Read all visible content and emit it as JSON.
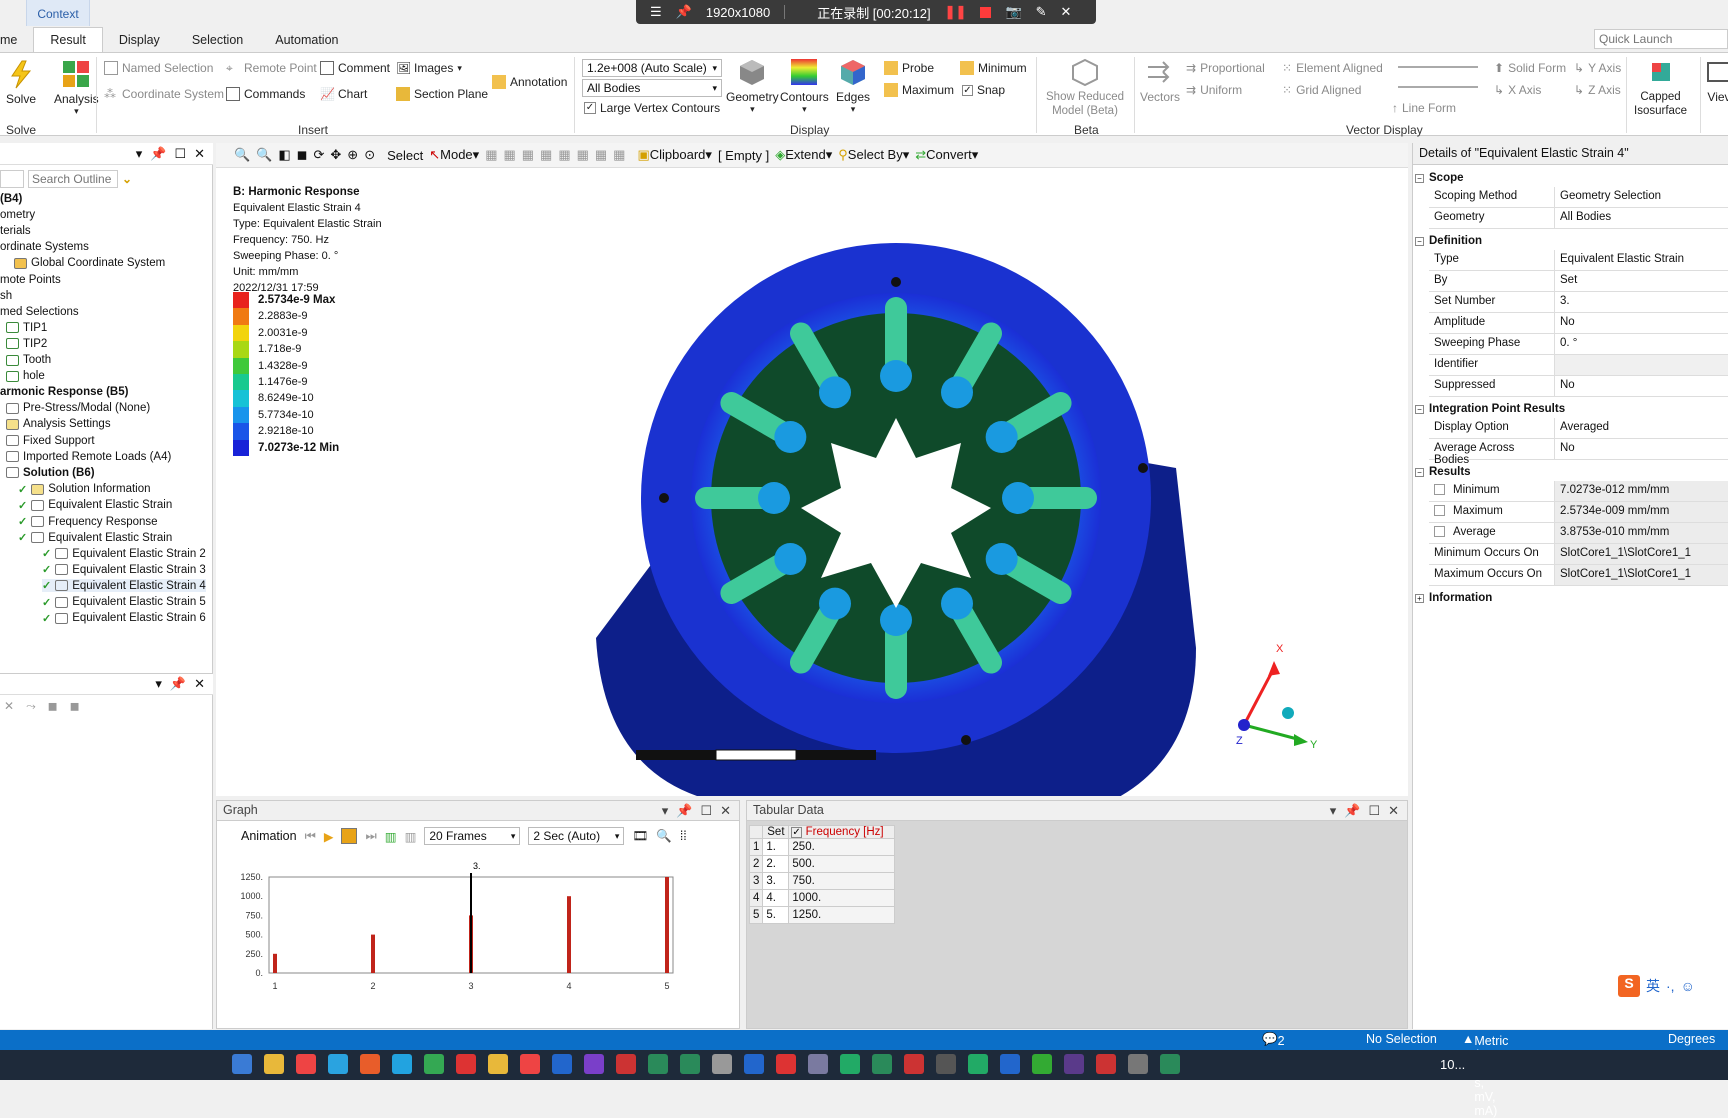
{
  "recording": {
    "resolution": "1920x1080",
    "status": "正在录制 [00:20:12]"
  },
  "ribbon": {
    "context_label": "Context",
    "tabs": [
      "me",
      "Result",
      "Display",
      "Selection",
      "Automation"
    ],
    "quick_launch_placeholder": "Quick Launch",
    "solve": "Solve",
    "analysis": "Analysis",
    "named_selection": "Named Selection",
    "remote_point": "Remote Point",
    "coordinate_system": "Coordinate System",
    "comment": "Comment",
    "images": "Images",
    "commands": "Commands",
    "chart": "Chart",
    "section_plane": "Section Plane",
    "annotation": "Annotation",
    "scale_select": "1.2e+008 (Auto Scale)",
    "bodies_select": "All Bodies",
    "large_vertex": "Large Vertex Contours",
    "geometry": "Geometry",
    "contours": "Contours",
    "edges": "Edges",
    "probe": "Probe",
    "maximum": "Maximum",
    "minimum": "Minimum",
    "snap": "Snap",
    "show_reduced": "Show Reduced",
    "model_beta": "Model (Beta)",
    "vectors": "Vectors",
    "proportional": "Proportional",
    "uniform": "Uniform",
    "element_aligned": "Element Aligned",
    "grid_aligned": "Grid Aligned",
    "line_form": "Line Form",
    "solid_form": "Solid Form",
    "x_axis": "X Axis",
    "y_axis": "Y Axis",
    "z_axis": "Z Axis",
    "capped": "Capped",
    "isosurface": "Isosurface",
    "view": "Viev",
    "groups": {
      "solve": "Solve",
      "insert": "Insert",
      "display": "Display",
      "beta": "Beta",
      "vector_display": "Vector Display"
    }
  },
  "outline": {
    "search_placeholder": "Search Outline",
    "items": [
      {
        "label": "(B4)",
        "bold": true
      },
      {
        "label": "ometry"
      },
      {
        "label": "terials"
      },
      {
        "label": "ordinate Systems"
      },
      {
        "label": "Global Coordinate System"
      },
      {
        "label": "mote Points"
      },
      {
        "label": "sh"
      },
      {
        "label": "med Selections"
      },
      {
        "label": "TIP1"
      },
      {
        "label": "TIP2"
      },
      {
        "label": "Tooth"
      },
      {
        "label": "hole"
      },
      {
        "label": "armonic Response (B5)",
        "bold": true
      },
      {
        "label": "Pre-Stress/Modal (None)"
      },
      {
        "label": "Analysis Settings"
      },
      {
        "label": "Fixed Support"
      },
      {
        "label": "Imported Remote Loads (A4)"
      },
      {
        "label": "Solution (B6)",
        "bold": true
      },
      {
        "label": "Solution Information"
      },
      {
        "label": "Equivalent Elastic Strain"
      },
      {
        "label": "Frequency Response"
      },
      {
        "label": "Equivalent Elastic Strain"
      },
      {
        "label": "Equivalent Elastic Strain 2"
      },
      {
        "label": "Equivalent Elastic Strain 3"
      },
      {
        "label": "Equivalent Elastic Strain 4"
      },
      {
        "label": "Equivalent Elastic Strain 5"
      },
      {
        "label": "Equivalent Elastic Strain 6"
      }
    ]
  },
  "viewport_toolbar": {
    "select": "Select",
    "mode": "Mode",
    "clipboard": "Clipboard",
    "empty": "[ Empty ]",
    "extend": "Extend",
    "select_by": "Select By",
    "convert": "Convert"
  },
  "result_info": {
    "title": "B: Harmonic Response",
    "name": "Equivalent Elastic Strain 4",
    "type": "Type: Equivalent Elastic Strain",
    "frequency": "Frequency: 750. Hz",
    "phase": "Sweeping Phase: 0. °",
    "unit": "Unit: mm/mm",
    "date": "2022/12/31 17:59"
  },
  "legend": {
    "labels": [
      "2.5734e-9 Max",
      "2.2883e-9",
      "2.0031e-9",
      "1.718e-9",
      "1.4328e-9",
      "1.1476e-9",
      "8.6249e-10",
      "5.7734e-10",
      "2.9218e-10",
      "7.0273e-12 Min"
    ],
    "colors": [
      "#e8231d",
      "#f07a12",
      "#f2d40c",
      "#a9d814",
      "#3fc93a",
      "#18c98f",
      "#16c2d6",
      "#1894ec",
      "#1a55e8",
      "#1822d8"
    ]
  },
  "triad": {
    "x": "X",
    "y": "Y",
    "z": "Z"
  },
  "details": {
    "title": "Details of \"Equivalent Elastic Strain 4\"",
    "sections": [
      {
        "name": "Scope",
        "rows": [
          [
            "Scoping Method",
            "Geometry Selection"
          ],
          [
            "Geometry",
            "All Bodies"
          ]
        ]
      },
      {
        "name": "Definition",
        "rows": [
          [
            "Type",
            "Equivalent Elastic Strain"
          ],
          [
            "By",
            "Set"
          ],
          [
            "Set Number",
            "3."
          ],
          [
            "Amplitude",
            "No"
          ],
          [
            "Sweeping Phase",
            "0. °"
          ],
          [
            "Identifier",
            ""
          ],
          [
            "Suppressed",
            "No"
          ]
        ]
      },
      {
        "name": "Integration Point Results",
        "rows": [
          [
            "Display Option",
            "Averaged"
          ],
          [
            "Average Across Bodies",
            "No"
          ]
        ]
      },
      {
        "name": "Results",
        "rows": [
          [
            "Minimum",
            "7.0273e-012 mm/mm"
          ],
          [
            "Maximum",
            "2.5734e-009 mm/mm"
          ],
          [
            "Average",
            "3.8753e-010 mm/mm"
          ],
          [
            "Minimum Occurs On",
            "SlotCore1_1\\SlotCore1_1"
          ],
          [
            "Maximum Occurs On",
            "SlotCore1_1\\SlotCore1_1"
          ]
        ]
      },
      {
        "name": "Information",
        "rows": []
      }
    ]
  },
  "graph": {
    "title": "Graph",
    "animation": "Animation",
    "frames": "20 Frames",
    "duration": "2 Sec (Auto)",
    "current_label": "3."
  },
  "chart_data": {
    "type": "bar",
    "categories": [
      "1",
      "2",
      "3",
      "4",
      "5"
    ],
    "values": [
      250,
      500,
      750,
      1000,
      1250
    ],
    "ylim": [
      0,
      1250
    ],
    "yticks": [
      "1250.",
      "1000.",
      "750.",
      "500.",
      "250.",
      "0."
    ],
    "xlabel": "",
    "ylabel": "",
    "title": ""
  },
  "tabular": {
    "title": "Tabular Data",
    "headers": [
      "Set",
      "Frequency [Hz]"
    ],
    "rows": [
      [
        "1",
        "1.",
        "250."
      ],
      [
        "2",
        "2.",
        "500."
      ],
      [
        "3",
        "3.",
        "750."
      ],
      [
        "4",
        "4.",
        "1000."
      ],
      [
        "5",
        "5.",
        "1250."
      ]
    ]
  },
  "status": {
    "messages": "2 Messages",
    "selection": "No Selection",
    "units": "Metric (mm, kg, N, s, mV, mA)",
    "angle": "Degrees"
  },
  "taskbar": {
    "time": "10..."
  },
  "ime": {
    "lang": "英"
  }
}
